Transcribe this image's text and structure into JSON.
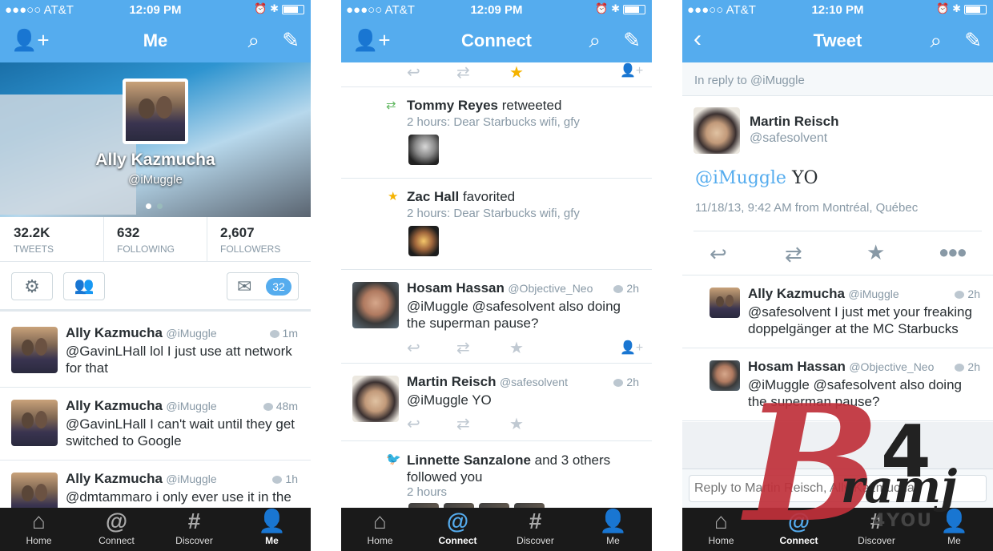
{
  "colors": {
    "accent": "#55acee",
    "tabbar": "#1a1a1a",
    "star": "#f5b300",
    "retweet": "#5fb75f",
    "watermark": "#c0303a"
  },
  "status_bar": {
    "p1": {
      "carrier": "●●●○○ AT&T",
      "time": "12:09 PM"
    },
    "p2": {
      "carrier": "●●●○○ AT&T",
      "time": "12:09 PM"
    },
    "p3": {
      "carrier": "●●●○○ AT&T",
      "time": "12:10 PM"
    }
  },
  "tabs": [
    "Home",
    "Connect",
    "Discover",
    "Me"
  ],
  "me": {
    "title": "Me",
    "profile": {
      "name": "Ally Kazmucha",
      "handle": "@iMuggle"
    },
    "stats": [
      {
        "value": "32.2K",
        "label": "TWEETS"
      },
      {
        "value": "632",
        "label": "FOLLOWING"
      },
      {
        "value": "2,607",
        "label": "FOLLOWERS"
      }
    ],
    "messages_count": "32",
    "tweets": [
      {
        "name": "Ally Kazmucha",
        "handle": "@iMuggle",
        "time": "1m",
        "text": "@GavinLHall lol I just use att network for that"
      },
      {
        "name": "Ally Kazmucha",
        "handle": "@iMuggle",
        "time": "48m",
        "text": "@GavinLHall I can't wait until they get switched to Google"
      },
      {
        "name": "Ally Kazmucha",
        "handle": "@iMuggle",
        "time": "1h",
        "text": "@dmtammaro i only ever use it in the"
      }
    ]
  },
  "connect": {
    "title": "Connect",
    "items": [
      {
        "actor": "Tommy Reyes",
        "verb": "retweeted",
        "sub": "2 hours: Dear Starbucks wifi, gfy"
      },
      {
        "actor": "Zac Hall",
        "verb": "favorited",
        "sub": "2 hours: Dear Starbucks wifi, gfy"
      },
      {
        "name": "Hosam Hassan",
        "handle": "@Objective_Neo",
        "time": "2h",
        "text": "@iMuggle @safesolvent also doing the superman pause?"
      },
      {
        "name": "Martin Reisch",
        "handle": "@safesolvent",
        "time": "2h",
        "text": "@iMuggle YO"
      },
      {
        "actor": "Linnette Sanzalone",
        "verb": "and 3 others followed you",
        "sub": "2 hours"
      }
    ]
  },
  "tweet": {
    "title": "Tweet",
    "in_reply": "In reply to @iMuggle",
    "author": {
      "name": "Martin Reisch",
      "handle": "@safesolvent"
    },
    "mention": "@iMuggle",
    "body": " YO",
    "meta": "11/18/13, 9:42 AM from Montréal, Québec",
    "replies": [
      {
        "name": "Ally Kazmucha",
        "handle": "@iMuggle",
        "time": "2h",
        "text": "@safesolvent I just met your freaking doppelgänger at the MC Starbucks"
      },
      {
        "name": "Hosam Hassan",
        "handle": "@Objective_Neo",
        "time": "2h",
        "text": "@iMuggle @safesolvent also doing the superman pause?"
      }
    ],
    "reply_placeholder": "Reply to Martin Reisch, Ally Kazmucha"
  },
  "watermark": {
    "b": "B",
    "four": "4",
    "ramj": "ramj",
    "you": "4YOU"
  }
}
